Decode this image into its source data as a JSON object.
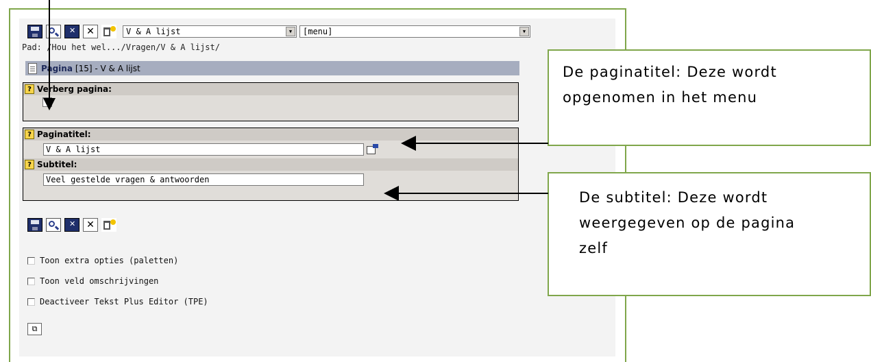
{
  "toolbar": {
    "page_select_value": "V & A lijst",
    "menu_select_value": "[menu]"
  },
  "path_text": "Pad: /Hou het wel.../Vragen/V & A lijst/",
  "page_header": {
    "label": "Pagina",
    "rest": "[15] - V & A lijst"
  },
  "fields": {
    "hide_label": "Verberg pagina:",
    "title_label": "Paginatitel:",
    "title_value": "V & A lijst",
    "subtitle_label": "Subtitel:",
    "subtitle_value": "Veel gestelde vragen & antwoorden"
  },
  "options": [
    "Toon extra opties (paletten)",
    "Toon veld omschrijvingen",
    "Deactiveer Tekst Plus Editor (TPE)"
  ],
  "callouts": {
    "title_note_line1": "De paginatitel: Deze wordt",
    "title_note_line2": "opgenomen in het menu",
    "subtitle_note_line1": "De subtitel: Deze wordt",
    "subtitle_note_line2": "weergegeven op de pagina",
    "subtitle_note_line3": "zelf"
  },
  "help_glyph": "?",
  "colors": {
    "frame_border": "#7fa64a",
    "header_bar": "#a6adbf",
    "help_icon": "#f7d44c"
  }
}
